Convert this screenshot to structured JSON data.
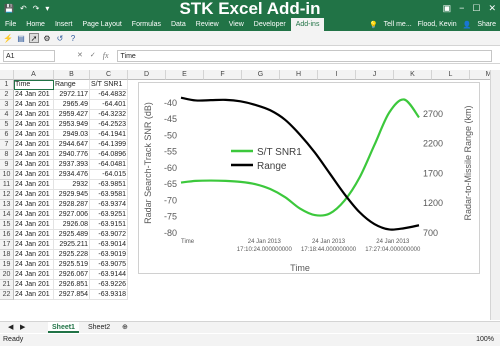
{
  "window": {
    "title": "STK Excel Add-in",
    "file_tab": "File",
    "tabs": [
      "Home",
      "Insert",
      "Page Layout",
      "Formulas",
      "Data",
      "Review",
      "View",
      "Developer",
      "Add-ins"
    ],
    "active_tab": "Add-ins",
    "tell_me": "Tell me...",
    "user": "Flood, Kevin",
    "share": "Share",
    "colors": {
      "excel_green": "#217346"
    }
  },
  "formula": {
    "namebox": "A1",
    "content": "Time"
  },
  "columns": [
    "A",
    "B",
    "C",
    "D",
    "E",
    "F",
    "G",
    "H",
    "I",
    "J",
    "K",
    "L",
    "M"
  ],
  "table": {
    "header": [
      "Time",
      "Range",
      "S/T SNR1"
    ],
    "rows": [
      [
        "24 Jan 201",
        "2972.117",
        "-64.4832"
      ],
      [
        "24 Jan 201",
        "2965.49",
        "-64.401"
      ],
      [
        "24 Jan 201",
        "2959.427",
        "-64.3232"
      ],
      [
        "24 Jan 201",
        "2953.949",
        "-64.2523"
      ],
      [
        "24 Jan 201",
        "2949.03",
        "-64.1941"
      ],
      [
        "24 Jan 201",
        "2944.647",
        "-64.1399"
      ],
      [
        "24 Jan 201",
        "2940.776",
        "-64.0896"
      ],
      [
        "24 Jan 201",
        "2937.393",
        "-64.0481"
      ],
      [
        "24 Jan 201",
        "2934.476",
        "-64.015"
      ],
      [
        "24 Jan 201",
        "2932",
        "-63.9851"
      ],
      [
        "24 Jan 201",
        "2929.945",
        "-63.9581"
      ],
      [
        "24 Jan 201",
        "2928.287",
        "-63.9374"
      ],
      [
        "24 Jan 201",
        "2927.006",
        "-63.9251"
      ],
      [
        "24 Jan 201",
        "2926.08",
        "-63.9151"
      ],
      [
        "24 Jan 201",
        "2925.489",
        "-63.9072"
      ],
      [
        "24 Jan 201",
        "2925.211",
        "-63.9014"
      ],
      [
        "24 Jan 201",
        "2925.228",
        "-63.9019"
      ],
      [
        "24 Jan 201",
        "2925.519",
        "-63.9075"
      ],
      [
        "24 Jan 201",
        "2926.067",
        "-63.9144"
      ],
      [
        "24 Jan 201",
        "2926.851",
        "-63.9226"
      ],
      [
        "24 Jan 201",
        "2927.854",
        "-63.9318"
      ]
    ]
  },
  "sheets": [
    "Sheet1",
    "Sheet2"
  ],
  "status": {
    "text": "Ready",
    "zoom": "100%"
  },
  "chart_data": {
    "type": "line",
    "title": "",
    "xlabel": "Time",
    "ylabel": "Radar Search-Track SNR (dB)",
    "y2label": "Radar-to-Missile Range (km)",
    "x_ticks": [
      "Time",
      "24 Jan 2013\n17:10:24.000000000",
      "24 Jan 2013\n17:18:44.000000000",
      "24 Jan 2013\n17:27:04.000000000"
    ],
    "y_ticks": [
      -40,
      -45,
      -50,
      -55,
      -60,
      -65,
      -70,
      -75,
      -80
    ],
    "ylim": [
      -80,
      -37
    ],
    "y2_ticks": [
      700,
      1200,
      1700,
      2200,
      2700
    ],
    "y2lim": [
      700,
      3050
    ],
    "legend_position": "center-left",
    "series": [
      {
        "name": "S/T SNR1",
        "axis": "left",
        "color": "#3cc83c",
        "values": [
          -64.5,
          -64.0,
          -63.9,
          -64.0,
          -64.3,
          -65.0,
          -66.5,
          -69.0,
          -72.5,
          -74.5,
          -74.0,
          -70.0,
          -63.0,
          -53.0,
          -43.0,
          -39.0,
          -44.5
        ]
      },
      {
        "name": "Range",
        "axis": "right",
        "color": "#000000",
        "values": [
          2972,
          2925,
          2930,
          2935,
          2910,
          2850,
          2760,
          2600,
          2350,
          2050,
          1700,
          1350,
          1050,
          850,
          760,
          780,
          830
        ]
      }
    ]
  }
}
